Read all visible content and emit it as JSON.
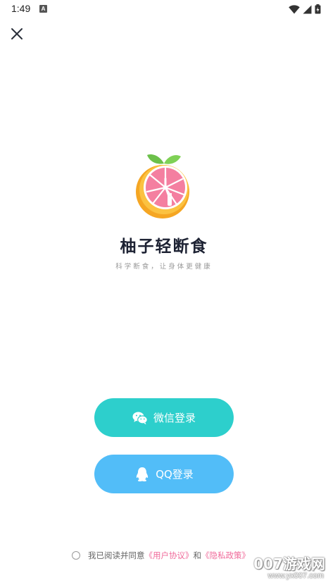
{
  "status_bar": {
    "time": "1:49",
    "app_icon_letter": "A"
  },
  "app": {
    "title": "柚子轻断食",
    "slogan": "科学断食，让身体更健康"
  },
  "buttons": {
    "wechat_label": "微信登录",
    "qq_label": "QQ登录"
  },
  "agreement": {
    "prefix": "我已阅读并同意",
    "user_agreement": "《用户协议》",
    "conjunction": "和",
    "privacy_policy": "《隐私政策》"
  },
  "watermark": {
    "brand": "007游戏网",
    "url": "www.yx007.com"
  },
  "colors": {
    "wechat_button": "#2dcfcc",
    "qq_button": "#52bdf8",
    "link": "#f06a9a",
    "title": "#1d2233"
  },
  "icons": {
    "close": "close-icon",
    "wechat": "wechat-icon",
    "qq": "qq-icon",
    "logo": "grapefruit-clock-logo"
  }
}
